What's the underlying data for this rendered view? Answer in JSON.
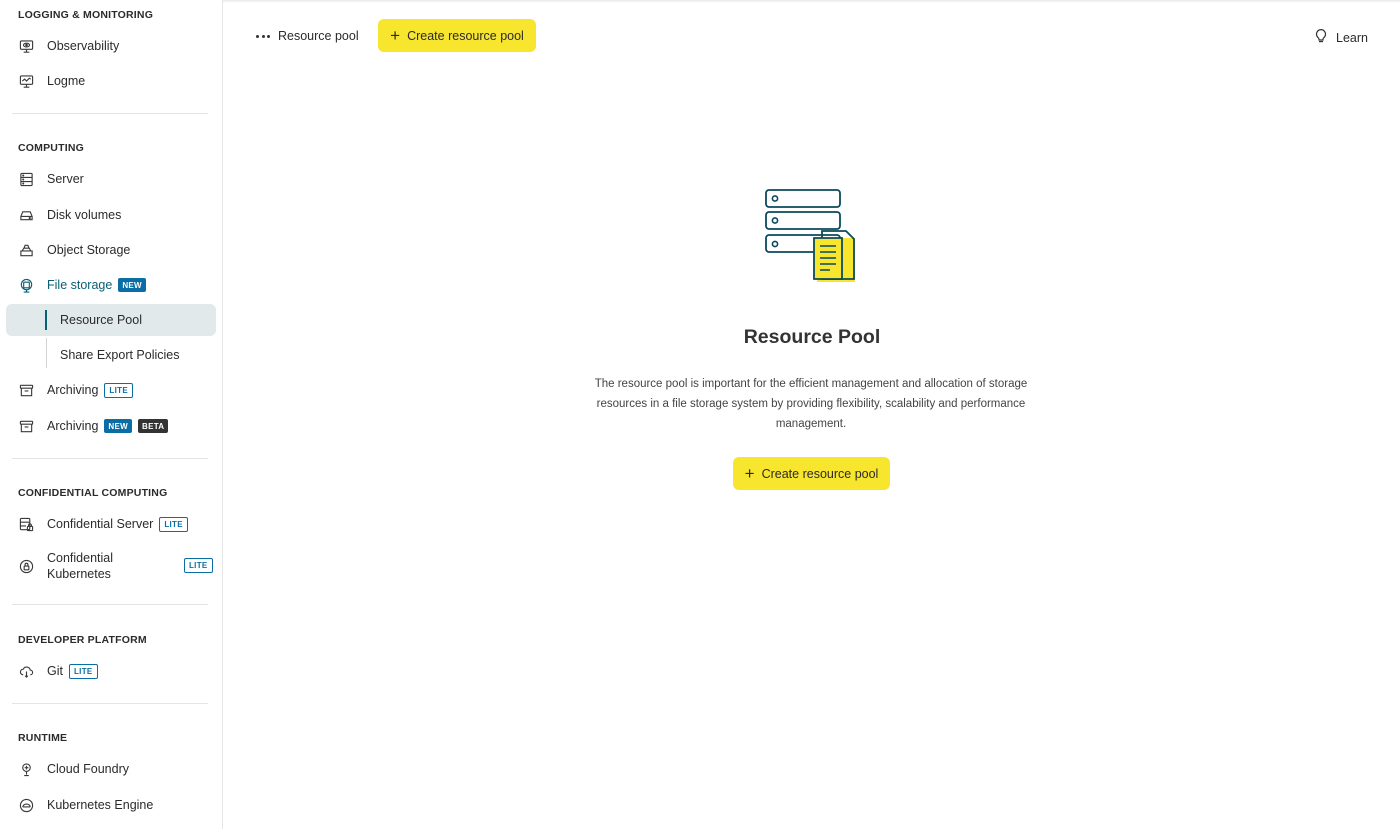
{
  "sidebar": {
    "logging": {
      "title": "LOGGING & MONITORING",
      "items": [
        {
          "label": "Observability",
          "icon": "monitor-eye-icon"
        },
        {
          "label": "Logme",
          "icon": "monitor-chart-icon"
        }
      ]
    },
    "computing": {
      "title": "COMPUTING",
      "items": [
        {
          "label": "Server",
          "icon": "server-rack-icon"
        },
        {
          "label": "Disk volumes",
          "icon": "disk-icon"
        },
        {
          "label": "Object Storage",
          "icon": "storage-stack-icon"
        },
        {
          "label": "File storage",
          "icon": "file-storage-icon",
          "badge": "NEW"
        },
        {
          "label": "Archiving",
          "icon": "archive-box-icon",
          "badge": "LITE"
        },
        {
          "label": "Archiving",
          "icon": "archive-box-icon",
          "badge": "NEW",
          "badge2": "BETA"
        }
      ],
      "file_storage_sub": [
        {
          "label": "Resource Pool"
        },
        {
          "label": "Share Export Policies"
        }
      ]
    },
    "confidential": {
      "title": "CONFIDENTIAL COMPUTING",
      "items": [
        {
          "label": "Confidential Server",
          "icon": "server-lock-icon",
          "badge": "LITE"
        },
        {
          "label_line1": "Confidential",
          "label_line2": "Kubernetes",
          "icon": "lock-circle-icon",
          "badge": "LITE"
        }
      ]
    },
    "developer": {
      "title": "DEVELOPER PLATFORM",
      "items": [
        {
          "label": "Git",
          "icon": "cloud-git-icon",
          "badge": "LITE"
        }
      ]
    },
    "runtime": {
      "title": "RUNTIME",
      "items": [
        {
          "label": "Cloud Foundry",
          "icon": "cloud-foundry-icon"
        },
        {
          "label": "Kubernetes Engine",
          "icon": "kubernetes-icon"
        }
      ]
    }
  },
  "topbar": {
    "breadcrumb": "Resource pool",
    "create_label": "Create resource pool",
    "learn_label": "Learn"
  },
  "empty_state": {
    "title": "Resource Pool",
    "description": "The resource pool is important for the efficient management and allocation of storage resources in a file storage system by providing flexibility, scalability and performance management.",
    "button_label": "Create resource pool"
  },
  "colors": {
    "accent_yellow": "#f7e52e",
    "teal": "#0a5f74",
    "badge_blue": "#0a6ea5",
    "selected_bg": "#e1e9ea"
  }
}
